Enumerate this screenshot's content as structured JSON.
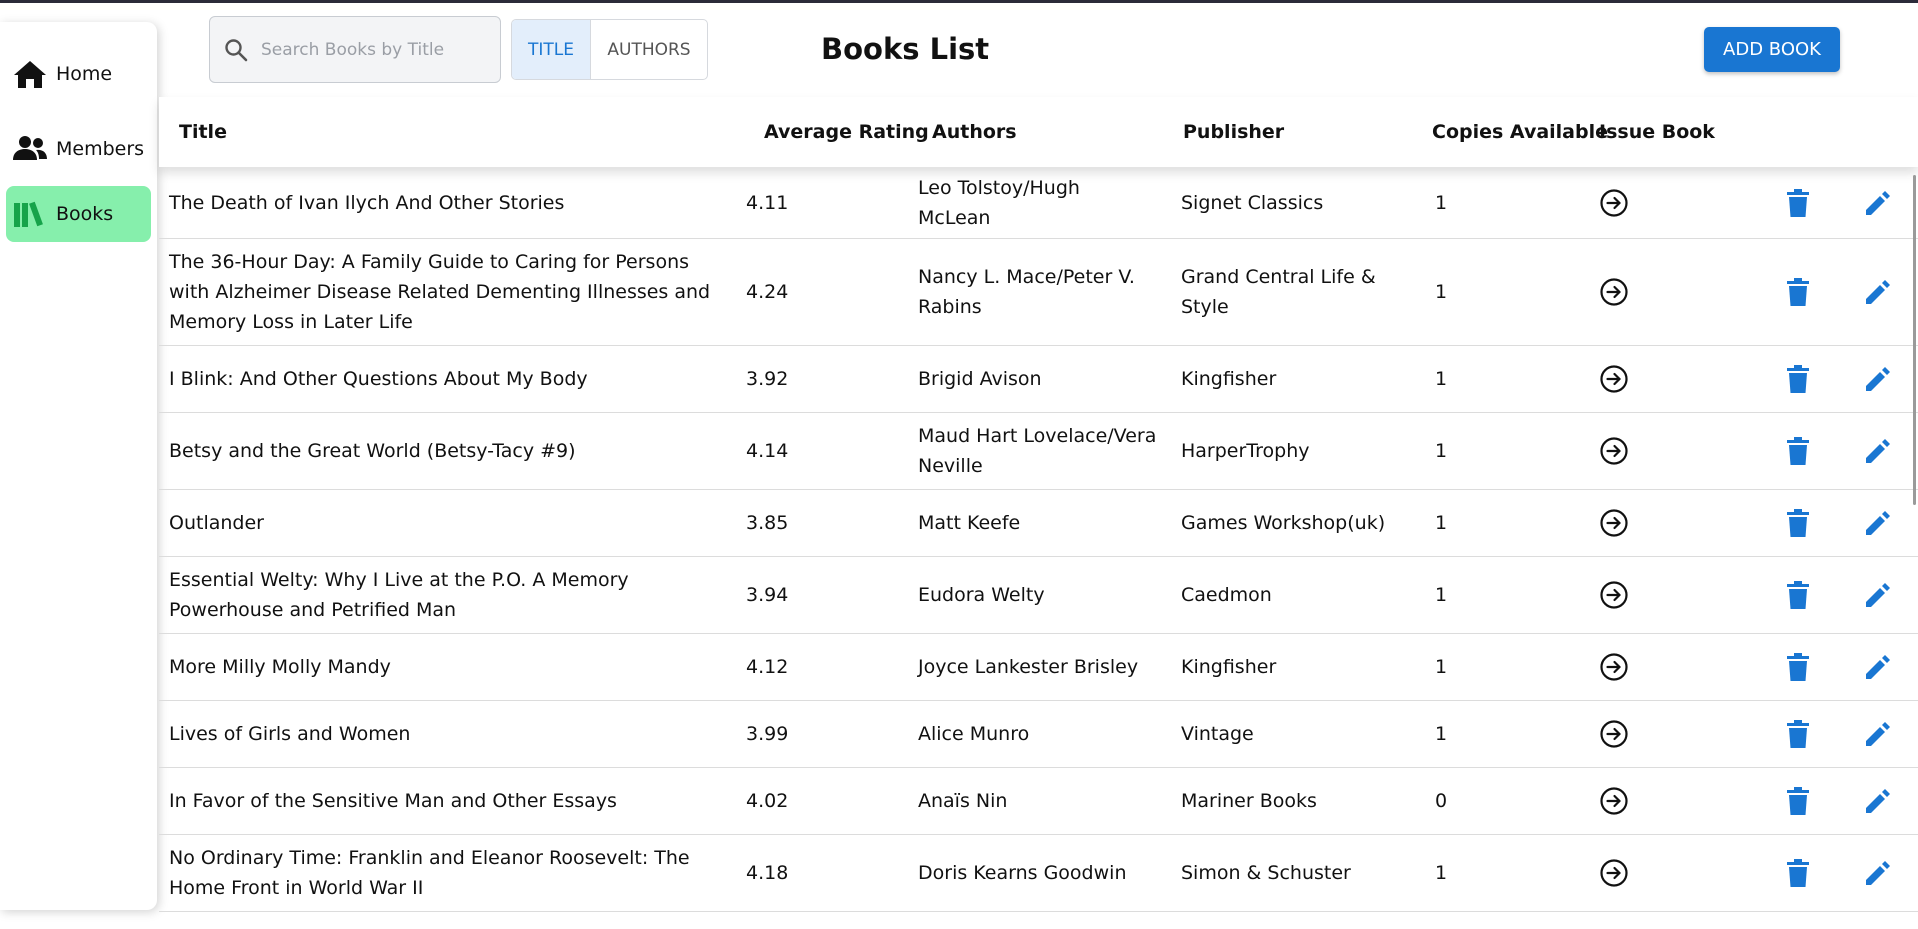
{
  "sidebar": {
    "items": [
      {
        "label": "Home",
        "icon": "home-icon"
      },
      {
        "label": "Members",
        "icon": "members-icon"
      },
      {
        "label": "Books",
        "icon": "books-icon",
        "active": true
      }
    ]
  },
  "search": {
    "placeholder": "Search Books by Title"
  },
  "search_mode": {
    "title": "TITLE",
    "authors": "AUTHORS",
    "selected": "TITLE"
  },
  "page_title": "Books List",
  "add_button": "ADD BOOK",
  "colors": {
    "accent": "#1976d2",
    "active_nav": "#86efac"
  },
  "table": {
    "headers": {
      "title": "Title",
      "rating": "Average Rating",
      "authors": "Authors",
      "publisher": "Publisher",
      "copies": "Copies Available",
      "issue": "Issue Book"
    },
    "rows": [
      {
        "title": "The Death of Ivan Ilych And Other Stories",
        "rating": "4.11",
        "authors": "Leo Tolstoy/Hugh McLean",
        "publisher": "Signet Classics",
        "copies": "1"
      },
      {
        "title": "The 36-Hour Day: A Family Guide to Caring for Persons with Alzheimer Disease Related Dementing Illnesses and Memory Loss in Later Life",
        "rating": "4.24",
        "authors": "Nancy L. Mace/Peter V. Rabins",
        "publisher": "Grand Central Life & Style",
        "copies": "1"
      },
      {
        "title": "I Blink: And Other Questions About My Body",
        "rating": "3.92",
        "authors": "Brigid Avison",
        "publisher": "Kingfisher",
        "copies": "1"
      },
      {
        "title": "Betsy and the Great World (Betsy-Tacy #9)",
        "rating": "4.14",
        "authors": "Maud Hart Lovelace/Vera Neville",
        "publisher": "HarperTrophy",
        "copies": "1"
      },
      {
        "title": "Outlander",
        "rating": "3.85",
        "authors": "Matt Keefe",
        "publisher": "Games Workshop(uk)",
        "copies": "1"
      },
      {
        "title": "Essential Welty: Why I Live at the P.O. A Memory Powerhouse and Petrified Man",
        "rating": "3.94",
        "authors": "Eudora Welty",
        "publisher": "Caedmon",
        "copies": "1"
      },
      {
        "title": "More Milly Molly Mandy",
        "rating": "4.12",
        "authors": "Joyce Lankester Brisley",
        "publisher": "Kingfisher",
        "copies": "1"
      },
      {
        "title": "Lives of Girls and Women",
        "rating": "3.99",
        "authors": "Alice Munro",
        "publisher": "Vintage",
        "copies": "1"
      },
      {
        "title": "In Favor of the Sensitive Man and Other Essays",
        "rating": "4.02",
        "authors": "Anaïs Nin",
        "publisher": "Mariner Books",
        "copies": "0"
      },
      {
        "title": "No Ordinary Time: Franklin and Eleanor Roosevelt: The Home Front in World War II",
        "rating": "4.18",
        "authors": "Doris Kearns Goodwin",
        "publisher": "Simon & Schuster",
        "copies": "1"
      }
    ]
  }
}
